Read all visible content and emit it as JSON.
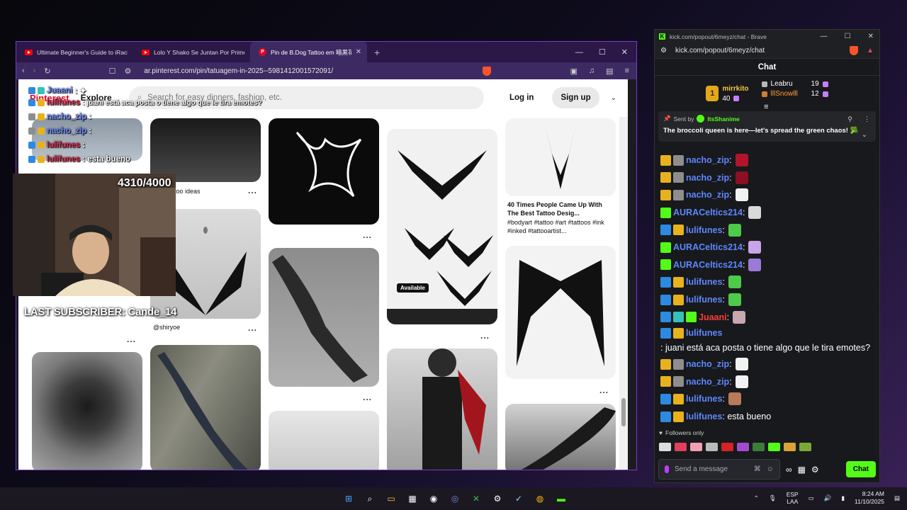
{
  "browser": {
    "tabs": [
      {
        "label": "Ultimate Beginner's Guide to iRacing",
        "icon": "youtube-icon"
      },
      {
        "label": "Lolo Y Shako Se Juntan Por Primera V",
        "icon": "youtube-icon"
      },
      {
        "label": "Pin de B.Dog Tattoo em 暗黒花",
        "icon": "pinterest-icon"
      }
    ],
    "new_tab": "+",
    "url": "ar.pinterest.com/pin/tatuagem-in-2025--5981412001572091/",
    "shield_count": "1"
  },
  "pinterest": {
    "logo": "Pinterest",
    "explore": "Explore",
    "search_placeholder": "Search for easy dinners, fashion, etc.",
    "login": "Log in",
    "signup": "Sign up",
    "captions": {
      "tattoo_ideas": "too ideas",
      "shiryoe": "@shiryoe",
      "forty_times_title": "40 Times People Came Up With The Best Tattoo Desig...",
      "forty_times_tags": "#bodyart #tattoo #art #tattoos #ink #inked #tattooartist...",
      "available": "Available"
    },
    "dots": "..."
  },
  "stream_overlay": {
    "chat": [
      {
        "name": "Juaani",
        "msg": ": ✦",
        "color": "blue"
      },
      {
        "name": "lulifunes",
        "msg": ": juani está aca posta o tiene algo que le tira emotes?",
        "color": "red"
      },
      {
        "name": "nacho_zip",
        "msg": ":",
        "color": "blue"
      },
      {
        "name": "nacho_zip",
        "msg": ":",
        "color": "blue"
      },
      {
        "name": "lulifunes",
        "msg": ":",
        "color": "red"
      },
      {
        "name": "lulifunes",
        "msg": ": esta bueno",
        "color": "red"
      }
    ],
    "sub_count": "4310/4000",
    "last_subscriber": "LAST SUBSCRIBER: Cande_14"
  },
  "kick": {
    "window_title": "kick.com/popout/6meyz/chat - Brave",
    "url": "kick.com/popout/6meyz/chat",
    "header": "Chat",
    "leaderboard": {
      "first": {
        "rank": "1",
        "name": "mirrkito",
        "count": "40"
      },
      "others": [
        {
          "name": "Leabru",
          "count": "19"
        },
        {
          "name": "lllSnowlll",
          "count": "12"
        }
      ]
    },
    "pinned": {
      "sent_by_label": "Sent by",
      "sender": "ItsShanime",
      "message": "The broccoli queen is here—let's spread the green chaos! 🥦"
    },
    "messages": [
      {
        "badges": [
          "crown",
          "gift"
        ],
        "name": "nacho_zip",
        "color": "blue",
        "text": ":",
        "emote": "#b3132b"
      },
      {
        "badges": [
          "crown",
          "gift"
        ],
        "name": "nacho_zip",
        "color": "blue",
        "text": ":",
        "emote": "#8c0f22"
      },
      {
        "badges": [
          "crown",
          "gift"
        ],
        "name": "nacho_zip",
        "color": "blue",
        "text": ":",
        "emote": "#f2f2f2"
      },
      {
        "badges": [
          "ver"
        ],
        "name": "AURACeltics214",
        "color": "blue",
        "text": ":",
        "emote": "#d9d9d9"
      },
      {
        "badges": [
          "mod",
          "crown"
        ],
        "name": "lulifunes",
        "color": "blue",
        "text": ":",
        "emote": "#4ec94a"
      },
      {
        "badges": [
          "ver"
        ],
        "name": "AURACeltics214",
        "color": "blue",
        "text": ":",
        "emote": "#c9a4e8"
      },
      {
        "badges": [
          "ver"
        ],
        "name": "AURACeltics214",
        "color": "blue",
        "text": ":",
        "emote": "#9a7ad6"
      },
      {
        "badges": [
          "mod",
          "crown"
        ],
        "name": "lulifunes",
        "color": "blue",
        "text": ":",
        "emote": "#4ec94a"
      },
      {
        "badges": [
          "mod",
          "crown"
        ],
        "name": "lulifunes",
        "color": "blue",
        "text": ":",
        "emote": "#4ec94a"
      },
      {
        "badges": [
          "mod",
          "og",
          "sub"
        ],
        "name": "Juaani",
        "color": "red",
        "text": ":",
        "emote": "#c9a6b0"
      },
      {
        "badges": [
          "mod",
          "crown"
        ],
        "name": "lulifunes",
        "color": "blue",
        "text": ": juani está aca posta o tiene algo que le tira emotes?",
        "emote": ""
      },
      {
        "badges": [
          "crown",
          "gift"
        ],
        "name": "nacho_zip",
        "color": "blue",
        "text": ":",
        "emote": "#f2f2f2"
      },
      {
        "badges": [
          "crown",
          "gift"
        ],
        "name": "nacho_zip",
        "color": "blue",
        "text": ":",
        "emote": "#f2f2f2"
      },
      {
        "badges": [
          "mod",
          "crown"
        ],
        "name": "lulifunes",
        "color": "blue",
        "text": ":",
        "emote": "#b77a5a"
      },
      {
        "badges": [
          "mod",
          "crown"
        ],
        "name": "lulifunes",
        "color": "blue",
        "text": ": esta bueno",
        "emote": ""
      }
    ],
    "followers_only": "Followers only",
    "send_placeholder": "Send a message",
    "chat_button": "Chat"
  },
  "taskbar": {
    "lang_top": "ESP",
    "lang_bottom": "LAA",
    "time": "8:24 AM",
    "date": "11/10/2025"
  }
}
